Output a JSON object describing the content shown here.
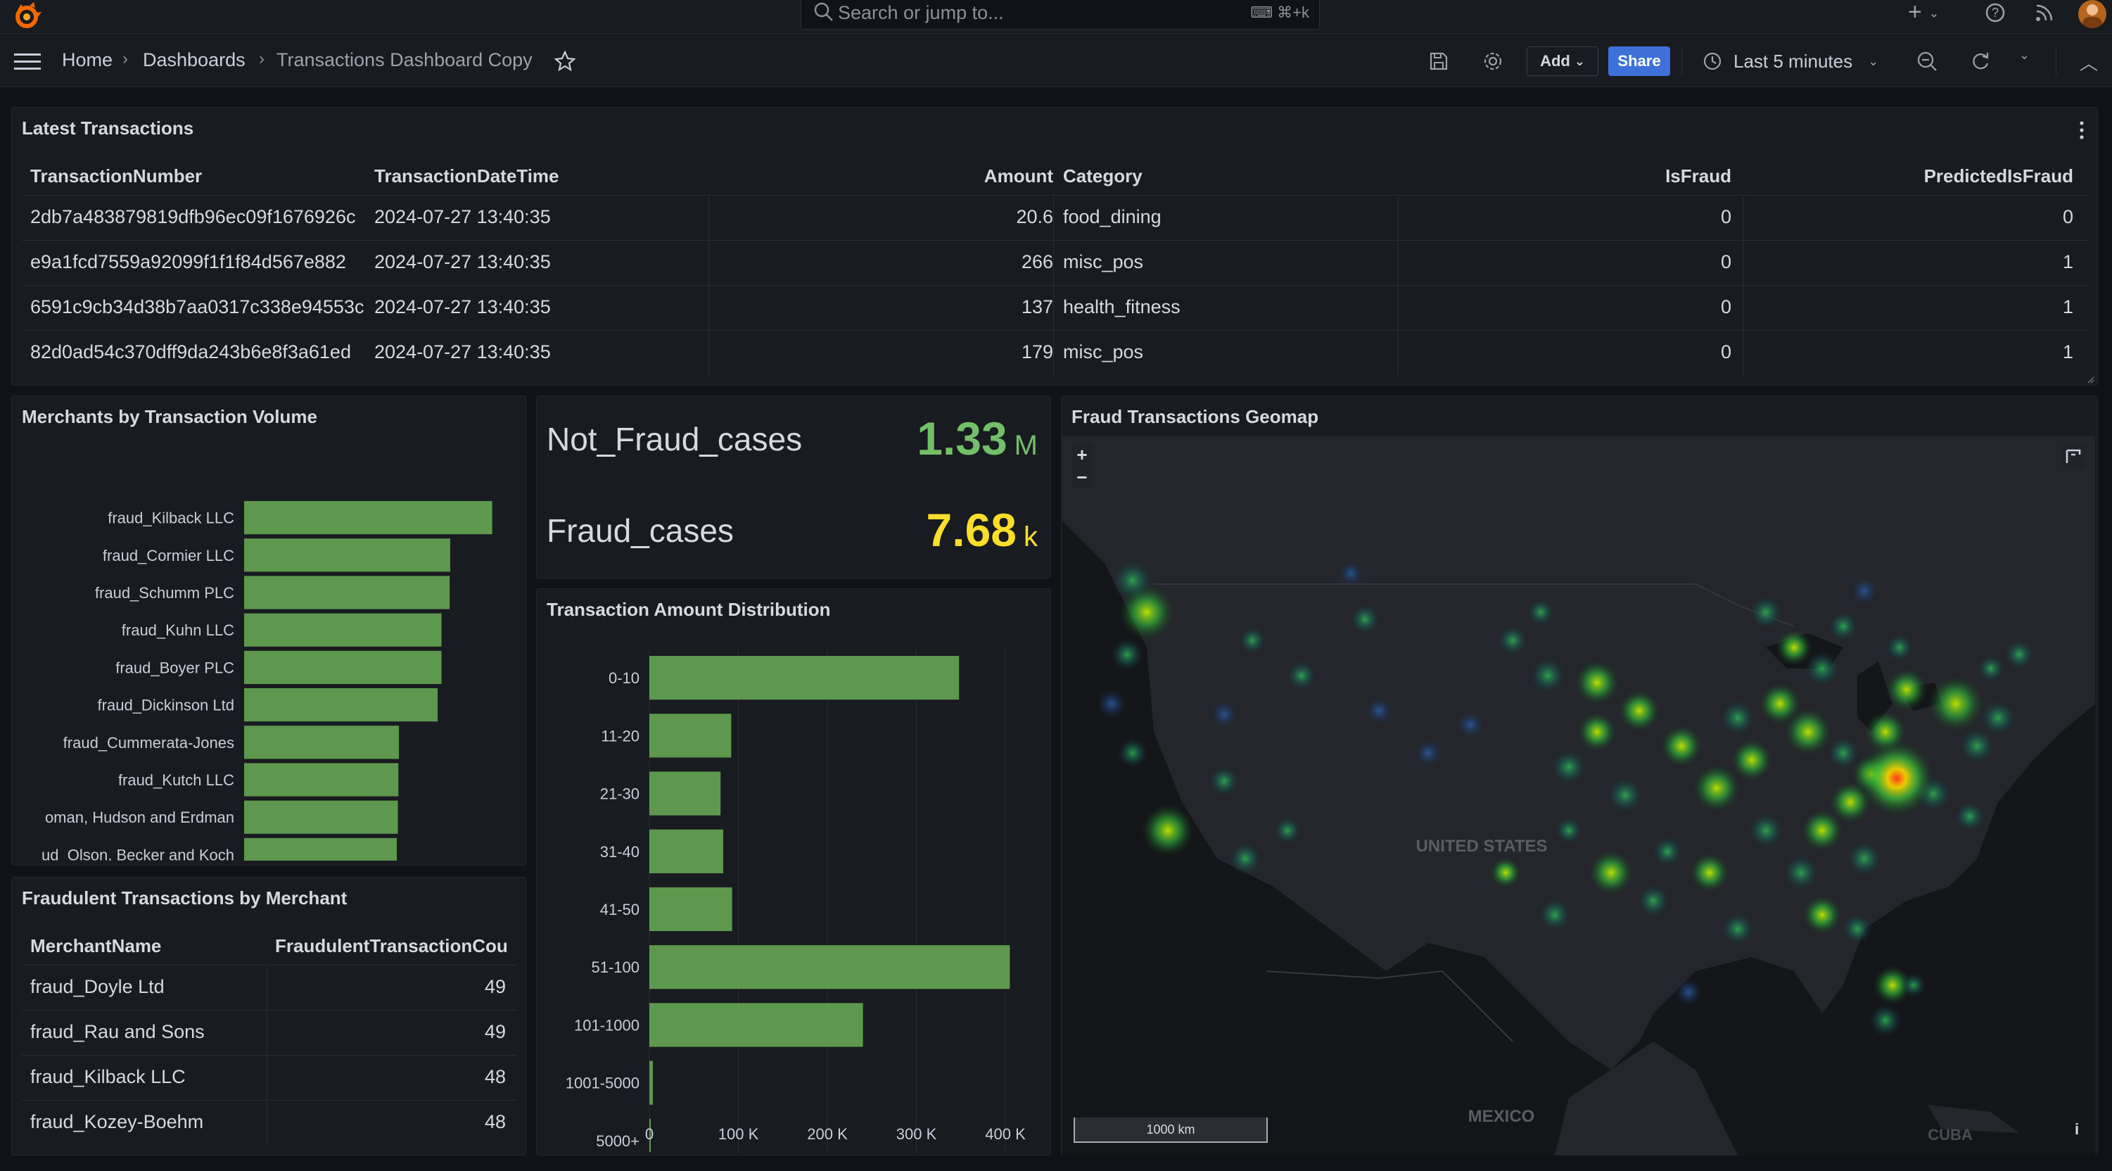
{
  "topbar": {
    "search_placeholder": "Search or jump to...",
    "shortcut": "⌘+k",
    "plus": "+",
    "avatar_name": "user-avatar"
  },
  "nav": {
    "breadcrumb": [
      "Home",
      "Dashboards",
      "Transactions Dashboard Copy"
    ],
    "add_label": "Add",
    "share_label": "Share",
    "time_range": "Last 5 minutes"
  },
  "latest_transactions": {
    "title": "Latest Transactions",
    "columns": [
      "TransactionNumber",
      "TransactionDateTime",
      "Amount",
      "Category",
      "IsFraud",
      "PredictedIsFraud"
    ],
    "rows": [
      [
        "2db7a483879819dfb96ec09f1676926c",
        "2024-07-27 13:40:35",
        "20.6",
        "food_dining",
        "0",
        "0"
      ],
      [
        "e9a1fcd7559a92099f1f1f84d567e882",
        "2024-07-27 13:40:35",
        "266",
        "misc_pos",
        "0",
        "1"
      ],
      [
        "6591c9cb34d38b7aa0317c338e94553c",
        "2024-07-27 13:40:35",
        "137",
        "health_fitness",
        "0",
        "1"
      ],
      [
        "82d0ad54c370dff9da243b6e8f3a61ed",
        "2024-07-27 13:40:35",
        "179",
        "misc_pos",
        "0",
        "1"
      ]
    ]
  },
  "merchants_panel": {
    "title": "Merchants by Transaction Volume"
  },
  "stats": {
    "not_fraud_label": "Not_Fraud_cases",
    "not_fraud_value": "1.33",
    "not_fraud_unit": "M",
    "fraud_label": "Fraud_cases",
    "fraud_value": "7.68",
    "fraud_unit": "k",
    "colors": {
      "not_fraud": "#73bf69",
      "fraud": "#fade2a"
    }
  },
  "distribution_panel": {
    "title": "Transaction Amount Distribution"
  },
  "fraud_by_merchant": {
    "title": "Fraudulent Transactions by Merchant",
    "columns": [
      "MerchantName",
      "FraudulentTransactionCou"
    ],
    "rows": [
      [
        "fraud_Doyle Ltd",
        "49"
      ],
      [
        "fraud_Rau and Sons",
        "49"
      ],
      [
        "fraud_Kilback LLC",
        "48"
      ],
      [
        "fraud_Kozey-Boehm",
        "48"
      ]
    ]
  },
  "geomap": {
    "title": "Fraud Transactions Geomap",
    "zoom_in": "+",
    "zoom_out": "−",
    "scale": "1000 km",
    "country_labels": [
      "UNITED STATES",
      "MEXICO",
      "CUBA"
    ],
    "info": "i"
  },
  "chart_data": [
    {
      "type": "bar",
      "orientation": "horizontal",
      "categories": [
        "fraud_Kilback LLC",
        "fraud_Cormier LLC",
        "fraud_Schumm PLC",
        "fraud_Kuhn LLC",
        "fraud_Boyer PLC",
        "fraud_Dickinson Ltd",
        "fraud_Cummerata-Jones",
        "fraud_Kutch LLC",
        "oman, Hudson and Erdman",
        "ud_Olson, Becker and Koch"
      ],
      "values": [
        4550,
        3780,
        3770,
        3620,
        3620,
        3550,
        2840,
        2830,
        2820,
        2800
      ],
      "xlim": [
        0,
        4800
      ],
      "xticks": [
        "0",
        "1 K",
        "2 K",
        "3 K",
        "4 K"
      ],
      "xtick_values": [
        0,
        1000,
        2000,
        3000,
        4000
      ],
      "color": "#629e51"
    },
    {
      "type": "bar",
      "orientation": "horizontal",
      "categories": [
        "0-10",
        "11-20",
        "21-30",
        "31-40",
        "41-50",
        "51-100",
        "101-1000",
        "1001-5000",
        "5000+"
      ],
      "values": [
        348000,
        92000,
        80000,
        83000,
        93000,
        405000,
        240000,
        4000,
        600
      ],
      "xlim": [
        0,
        430000
      ],
      "xticks": [
        "0",
        "100 K",
        "200 K",
        "300 K",
        "400 K"
      ],
      "xtick_values": [
        0,
        100000,
        200000,
        300000,
        400000
      ],
      "color": "#629e51"
    }
  ]
}
